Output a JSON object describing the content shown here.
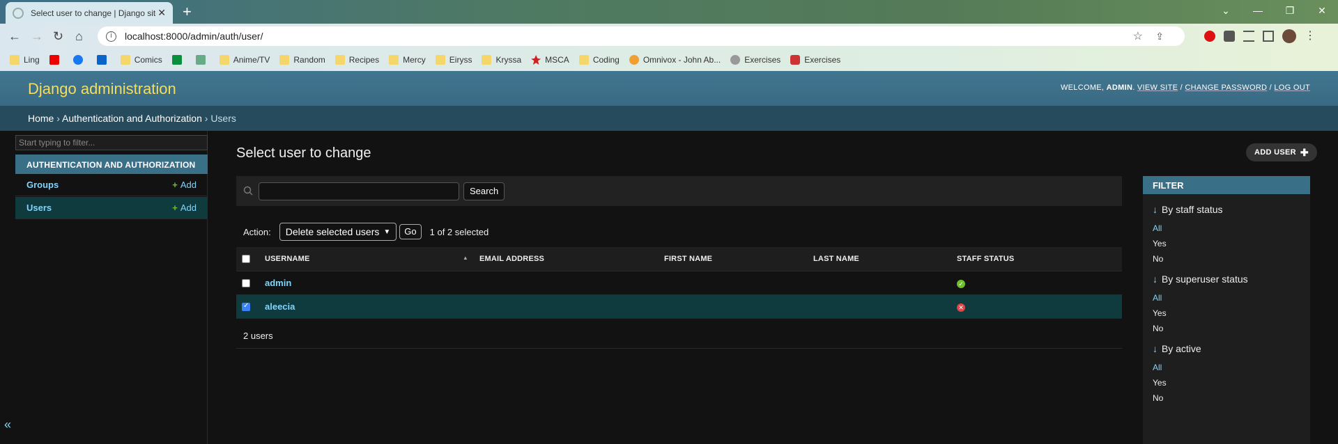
{
  "browser": {
    "tab_title": "Select user to change | Django site admin",
    "url": "localhost:8000/admin/auth/user/",
    "bookmarks": [
      "Ling",
      "",
      "",
      "",
      "Comics",
      "",
      "",
      "Anime/TV",
      "Random",
      "Recipes",
      "Mercy",
      "Eiryss",
      "Kryssa",
      "MSCA",
      "Coding",
      "Omnivox - John Ab...",
      "Exercises",
      "Exercises"
    ]
  },
  "header": {
    "site_name": "Django administration",
    "welcome": "WELCOME,",
    "username": "ADMIN",
    "view_site": "VIEW SITE",
    "change_password": "CHANGE PASSWORD",
    "log_out": "LOG OUT",
    "sep": "/"
  },
  "breadcrumbs": {
    "home": "Home",
    "app": "Authentication and Authorization",
    "current": "Users",
    "sep": "›"
  },
  "sidebar": {
    "filter_placeholder": "Start typing to filter...",
    "app_caption": "AUTHENTICATION AND AUTHORIZATION",
    "models": [
      {
        "name": "Groups",
        "add": "Add"
      },
      {
        "name": "Users",
        "add": "Add"
      }
    ],
    "collapse_glyph": "«"
  },
  "content": {
    "title": "Select user to change",
    "add_button": "ADD USER",
    "search_button": "Search",
    "action_label": "Action:",
    "action_selected": "Delete selected users",
    "go_button": "Go",
    "counter": "1 of 2 selected",
    "columns": [
      "USERNAME",
      "EMAIL ADDRESS",
      "FIRST NAME",
      "LAST NAME",
      "STAFF STATUS"
    ],
    "rows": [
      {
        "username": "admin",
        "email": "",
        "first_name": "",
        "last_name": "",
        "staff": true,
        "selected": false
      },
      {
        "username": "aleecia",
        "email": "",
        "first_name": "",
        "last_name": "",
        "staff": false,
        "selected": true
      }
    ],
    "paginator": "2 users"
  },
  "filter": {
    "title": "FILTER",
    "groups": [
      {
        "title": "By staff status",
        "options": [
          "All",
          "Yes",
          "No"
        ]
      },
      {
        "title": "By superuser status",
        "options": [
          "All",
          "Yes",
          "No"
        ]
      },
      {
        "title": "By active",
        "options": [
          "All",
          "Yes",
          "No"
        ]
      }
    ]
  },
  "colors": {
    "header_bg": "#417690",
    "breadcrumb_bg": "#264b5d",
    "link": "#81d4fa",
    "selected_row": "#0f3b3f",
    "site_name": "#f5dd5d"
  }
}
